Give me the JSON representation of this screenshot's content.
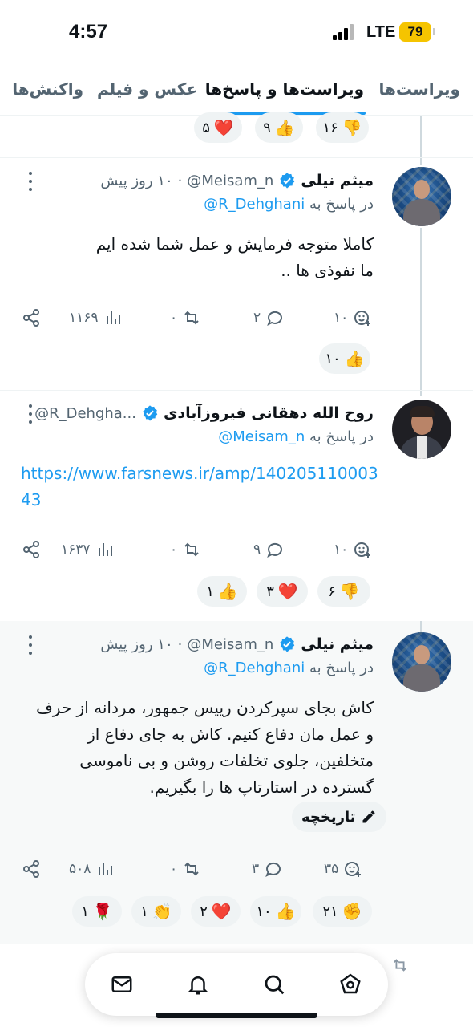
{
  "status_bar": {
    "time": "4:57",
    "network": "LTE",
    "battery": "79"
  },
  "tabs": [
    {
      "label": "ویراست‌ها",
      "active": false
    },
    {
      "label": "ویراست‌ها و پاسخ‌ها",
      "active": true
    },
    {
      "label": "عکس و فیلم",
      "active": false
    },
    {
      "label": "واکنش‌ها",
      "active": false
    }
  ],
  "top_reactions": [
    {
      "emoji": "👎",
      "count": "۱۶"
    },
    {
      "emoji": "👍",
      "count": "۹"
    },
    {
      "emoji": "❤️",
      "count": "۵"
    }
  ],
  "tweets": [
    {
      "name": "میثم نیلی",
      "handle": "@Meisam_n",
      "time": "۱۰ روز پیش",
      "reply_prefix": "در پاسخ به",
      "reply_to": "@R_Dehghani",
      "text_lines": [
        "کاملا متوجه فرمایش و عمل شما شده ایم",
        "ما نفوذی ها .."
      ],
      "actions": {
        "likes": "۱۰",
        "replies": "۲",
        "retweets": "۰",
        "views": "۱۱۶۹"
      },
      "reactions": [
        {
          "emoji": "👍",
          "count": "۱۰"
        }
      ]
    },
    {
      "name": "روح الله دهقانی فیروزآبادی",
      "handle": "@R_Dehgha...",
      "reply_prefix": "در پاسخ به",
      "reply_to": "@Meisam_n",
      "link": "https://www.farsnews.ir/amp/14020511000343",
      "actions": {
        "likes": "۱۰",
        "replies": "۹",
        "retweets": "۰",
        "views": "۱۶۳۷"
      },
      "reactions": [
        {
          "emoji": "👎",
          "count": "۶"
        },
        {
          "emoji": "❤️",
          "count": "۳"
        },
        {
          "emoji": "👍",
          "count": "۱"
        }
      ]
    },
    {
      "name": "میثم نیلی",
      "handle": "@Meisam_n",
      "time": "۱۰ روز پیش",
      "reply_prefix": "در پاسخ به",
      "reply_to": "@R_Dehghani",
      "text_lines": [
        "کاش بجای سپرکردن رییس جمهور، مردانه از حرف",
        "و عمل مان دفاع کنیم. کاش به جای دفاع از",
        "متخلفین، جلوی تخلفات روشن  و بی ناموسی",
        "گسترده در استارتاپ ها را بگیریم."
      ],
      "history_label": "تاریخچه",
      "actions": {
        "likes": "۳۵",
        "replies": "۳",
        "retweets": "۰",
        "views": "۵۰۸"
      },
      "reactions": [
        {
          "emoji": "✊",
          "count": "۲۱"
        },
        {
          "emoji": "👍",
          "count": "۱۰"
        },
        {
          "emoji": "❤️",
          "count": "۲"
        },
        {
          "emoji": "👏",
          "count": "۱"
        },
        {
          "emoji": "🌹",
          "count": "۱"
        }
      ]
    }
  ],
  "bottom_nav": [
    "mail-icon",
    "bell-icon",
    "search-icon",
    "home-icon"
  ],
  "colors": {
    "accent": "#1d9bf0",
    "text": "#0f1419",
    "muted": "#536471",
    "pill_bg": "#eff3f4",
    "battery": "#f5c400"
  }
}
